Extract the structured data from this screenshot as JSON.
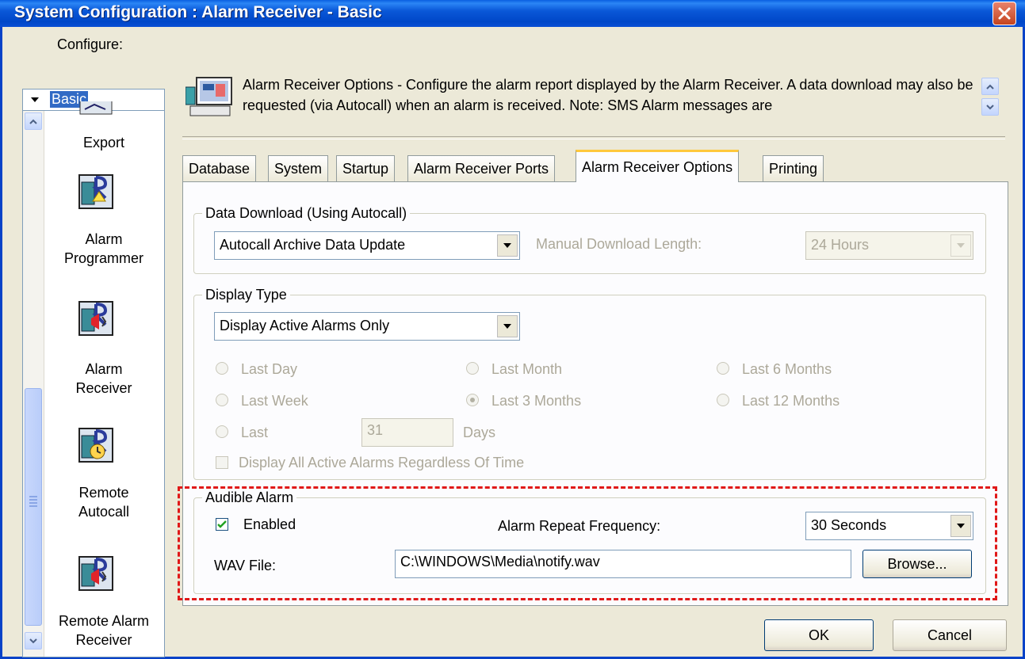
{
  "window": {
    "title": "System Configuration : Alarm Receiver - Basic"
  },
  "configure": {
    "label": "Configure:",
    "selected": "Basic"
  },
  "sidebar": {
    "items": [
      {
        "label_line1": "Export",
        "label_line2": "",
        "icon": "export-icon"
      },
      {
        "label_line1": "Alarm",
        "label_line2": "Programmer",
        "icon": "alarm-programmer-icon"
      },
      {
        "label_line1": "Alarm",
        "label_line2": "Receiver",
        "icon": "alarm-receiver-icon"
      },
      {
        "label_line1": "Remote",
        "label_line2": "Autocall",
        "icon": "remote-autocall-icon"
      },
      {
        "label_line1": "Remote Alarm",
        "label_line2": "Receiver",
        "icon": "remote-alarm-receiver-icon"
      }
    ]
  },
  "header": {
    "description": "Alarm Receiver Options - Configure the alarm report displayed by the Alarm Receiver. A data download may also be requested (via Autocall) when an alarm is received. Note: SMS Alarm messages are"
  },
  "tabs": [
    {
      "label": "Database",
      "active": false
    },
    {
      "label": "System",
      "active": false
    },
    {
      "label": "Startup",
      "active": false
    },
    {
      "label": "Alarm Receiver Ports",
      "active": false
    },
    {
      "label": "Alarm Receiver Options",
      "active": true
    },
    {
      "label": "Printing",
      "active": false
    }
  ],
  "data_download": {
    "title": "Data Download (Using Autocall)",
    "selected": "Autocall Archive Data Update",
    "manual_label": "Manual Download Length:",
    "manual_value": "24 Hours"
  },
  "display_type": {
    "title": "Display Type",
    "selected": "Display Active Alarms Only",
    "radios": {
      "last_day": "Last Day",
      "last_month": "Last Month",
      "last_6_months": "Last 6 Months",
      "last_week": "Last Week",
      "last_3_months": "Last 3 Months",
      "last_12_months": "Last 12 Months",
      "last": "Last"
    },
    "selected_radio": "Last 3 Months",
    "days_value": "31",
    "days_label": "Days",
    "display_all_label": "Display All Active Alarms Regardless Of Time"
  },
  "audible_alarm": {
    "title": "Audible Alarm",
    "enabled_label": "Enabled",
    "enabled_checked": true,
    "repeat_label": "Alarm Repeat Frequency:",
    "repeat_value": "30 Seconds",
    "wav_label": "WAV File:",
    "wav_value": "C:\\WINDOWS\\Media\\notify.wav",
    "browse_label": "Browse..."
  },
  "buttons": {
    "ok": "OK",
    "cancel": "Cancel"
  },
  "colors": {
    "title_bar": "#0a58d8",
    "highlight": "#e01818",
    "tab_active_accent": "#ffc83c"
  }
}
